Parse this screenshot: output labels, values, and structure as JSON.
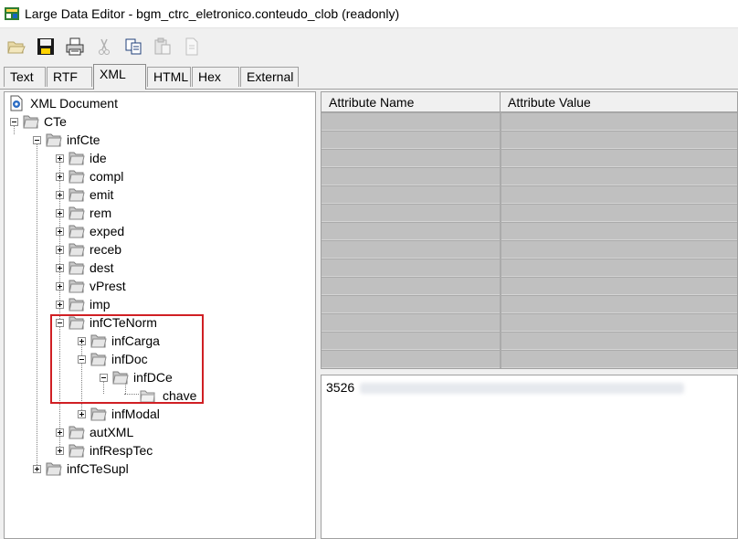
{
  "window": {
    "title": "Large Data Editor - bgm_ctrc_eletronico.conteudo_clob (readonly)"
  },
  "toolbar": {
    "buttons": [
      {
        "name": "open-icon",
        "enabled": false
      },
      {
        "name": "save-icon",
        "enabled": true
      },
      {
        "name": "print-icon",
        "enabled": true
      },
      {
        "name": "cut-icon",
        "enabled": false
      },
      {
        "name": "copy-icon",
        "enabled": true
      },
      {
        "name": "paste-icon",
        "enabled": false
      },
      {
        "name": "clear-icon",
        "enabled": false
      }
    ]
  },
  "tabs": [
    "Text",
    "RTF",
    "XML",
    "HTML",
    "Hex",
    "External"
  ],
  "active_tab": "XML",
  "tree": {
    "root": "XML Document",
    "nodes": {
      "cte": "CTe",
      "infcte": "infCte",
      "ide": "ide",
      "compl": "compl",
      "emit": "emit",
      "rem": "rem",
      "exped": "exped",
      "receb": "receb",
      "dest": "dest",
      "vprest": "vPrest",
      "imp": "imp",
      "infctenorm": "infCTeNorm",
      "infcarga": "infCarga",
      "infdoc": "infDoc",
      "infdce": "infDCe",
      "chave": "chave",
      "infmodal": "infModal",
      "autxml": "autXML",
      "infresptec": "infRespTec",
      "infctesupl": "infCTeSupl"
    },
    "selected": "chave"
  },
  "attributes": {
    "columns": [
      "Attribute Name",
      "Attribute Value"
    ],
    "rows": []
  },
  "value": {
    "visible_prefix": "3526",
    "redacted": true
  },
  "colors": {
    "highlight": "#d01f24",
    "grid_empty": "#ababab"
  }
}
